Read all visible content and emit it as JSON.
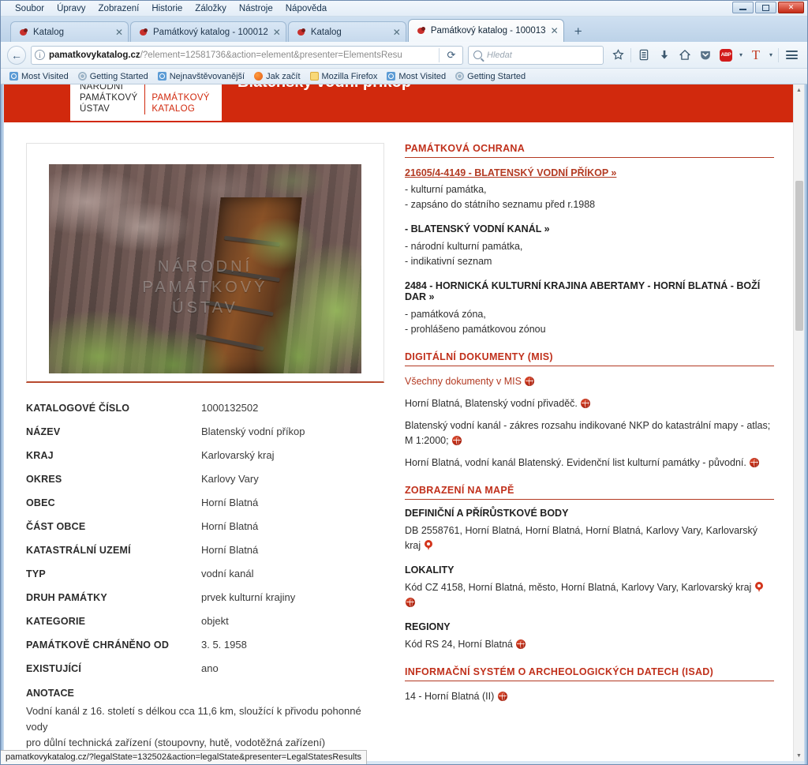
{
  "window": {
    "controls": {
      "minimize": "minimize-button",
      "maximize": "maximize-button",
      "close": "close-button"
    }
  },
  "menubar": {
    "items": [
      "Soubor",
      "Úpravy",
      "Zobrazení",
      "Historie",
      "Záložky",
      "Nástroje",
      "Nápověda"
    ]
  },
  "tabs": [
    {
      "title": "Katalog",
      "active": false
    },
    {
      "title": "Památkový katalog - 100012",
      "active": false
    },
    {
      "title": "Katalog",
      "active": false
    },
    {
      "title": "Památkový katalog - 100013",
      "active": true
    }
  ],
  "newtab_label": "+",
  "toolbar": {
    "back_glyph": "←",
    "url_host": "pamatkovykatalog.cz",
    "url_path": "/?element=12581736&action=element&presenter=ElementsResu",
    "reload_glyph": "⟳",
    "search_placeholder": "Hledat",
    "icons": [
      "bookmark-star-icon",
      "library-icon",
      "downloads-icon",
      "home-icon",
      "pocket-icon",
      "adblock-plus-icon",
      "tampermonkey-icon",
      "overflow-caret-icon",
      "menu-hamburger-icon"
    ],
    "adblock_label": "ABP",
    "tampermonkey_label": "T"
  },
  "bookmarks": [
    {
      "label": "Most Visited",
      "icon": "globe-blue-icon"
    },
    {
      "label": "Getting Started",
      "icon": "globe-grey-icon"
    },
    {
      "label": "Nejnavštěvovanější",
      "icon": "globe-blue-icon"
    },
    {
      "label": "Jak začít",
      "icon": "firefox-icon"
    },
    {
      "label": "Mozilla Firefox",
      "icon": "folder-icon"
    },
    {
      "label": "Most Visited",
      "icon": "globe-blue-icon"
    },
    {
      "label": "Getting Started",
      "icon": "globe-grey-icon"
    }
  ],
  "site": {
    "page_title": "Blatenský vodní příkop",
    "logo_line1": "NÁRODNÍ",
    "logo_line2": "PAMÁTKOVÝ",
    "logo_line3": "ÚSTAV",
    "logo_right_line1": "PAMÁTKOVÝ",
    "logo_right_line2": "KATALOG",
    "photo_watermark_line1": "NÁRODNÍ",
    "photo_watermark_line2": "PAMÁTKOVÝ",
    "photo_watermark_line3": "ÚSTAV",
    "accent_red": "#d1290d",
    "link_red": "#b33a22"
  },
  "details": [
    {
      "label": "KATALOGOVÉ ČÍSLO",
      "value": "1000132502"
    },
    {
      "label": "NÁZEV",
      "value": "Blatenský vodní příkop"
    },
    {
      "label": "KRAJ",
      "value": "Karlovarský kraj"
    },
    {
      "label": "OKRES",
      "value": "Karlovy Vary"
    },
    {
      "label": "OBEC",
      "value": "Horní Blatná"
    },
    {
      "label": "ČÁST OBCE",
      "value": "Horní Blatná"
    },
    {
      "label": "KATASTRÁLNÍ UZEMÍ",
      "value": "Horní Blatná"
    },
    {
      "label": "TYP",
      "value": "vodní kanál"
    },
    {
      "label": "DRUH PAMÁTKY",
      "value": "prvek kulturní krajiny"
    },
    {
      "label": "KATEGORIE",
      "value": "objekt"
    },
    {
      "label": "PAMÁTKOVĚ CHRÁNĚNO OD",
      "value": "3. 5. 1958"
    },
    {
      "label": "EXISTUJÍCÍ",
      "value": "ano"
    }
  ],
  "annotation": {
    "heading": "ANOTACE",
    "line1": "Vodní kanál z 16. století s délkou cca 11,6 km, sloužící k přivodu pohonné vody",
    "line2": "pro důlní technická zařízení (stoupovny, hutě, vodotěžná zařízení)"
  },
  "protection": {
    "title": "PAMÁTKOVÁ OCHRANA",
    "entries": [
      {
        "heading": "21605/4-4149 - BLATENSKÝ VODNÍ PŘÍKOP »",
        "is_link": true,
        "bullets": [
          "- kulturní památka,",
          "- zapsáno do státního seznamu před r.1988"
        ]
      },
      {
        "heading": "- BLATENSKÝ VODNÍ KANÁL »",
        "is_link": false,
        "bullets": [
          "- národní kulturní památka,",
          "- indikativní seznam"
        ]
      },
      {
        "heading": "2484 - HORNICKÁ KULTURNÍ KRAJINA ABERTAMY - HORNÍ BLATNÁ - BOŽÍ DAR »",
        "is_link": false,
        "bullets": [
          "- památková zóna,",
          "- prohlášeno památkovou zónou"
        ]
      }
    ]
  },
  "documents": {
    "title": "DIGITÁLNÍ DOKUMENTY (MIS)",
    "all_link": "Všechny dokumenty v MIS",
    "items": [
      "Horní Blatná, Blatenský vodní přivaděč.",
      "Blatenský vodní kanál - zákres rozsahu indikované NKP do katastrální mapy - atlas; M 1:2000;",
      "Horní Blatná, vodní kanál Blatenský. Evidenční list kulturní památky - původní."
    ]
  },
  "map": {
    "title": "ZOBRAZENÍ NA MAPĚ",
    "groups": [
      {
        "heading": "DEFINIČNÍ A PŘÍRŮSTKOVÉ BODY",
        "text": "DB 2558761, Horní Blatná, Horní Blatná, Horní Blatná, Karlovy Vary, Karlovarský kraj",
        "icons": [
          "pin-icon"
        ]
      },
      {
        "heading": "LOKALITY",
        "text": "Kód CZ 4158, Horní Blatná, město, Horní Blatná, Karlovy Vary, Karlovarský kraj",
        "icons": [
          "pin-icon",
          "globe-icon"
        ]
      },
      {
        "heading": "REGIONY",
        "text": "Kód RS 24, Horní Blatná",
        "icons": [
          "globe-icon"
        ]
      }
    ]
  },
  "isad": {
    "title": "INFORMAČNÍ SYSTÉM O ARCHEOLOGICKÝCH DATECH (ISAD)",
    "item": "14 - Horní Blatná (II)"
  },
  "statusbar": {
    "url": "pamatkovykatalog.cz/?legalState=132502&action=legalState&presenter=LegalStatesResults"
  }
}
